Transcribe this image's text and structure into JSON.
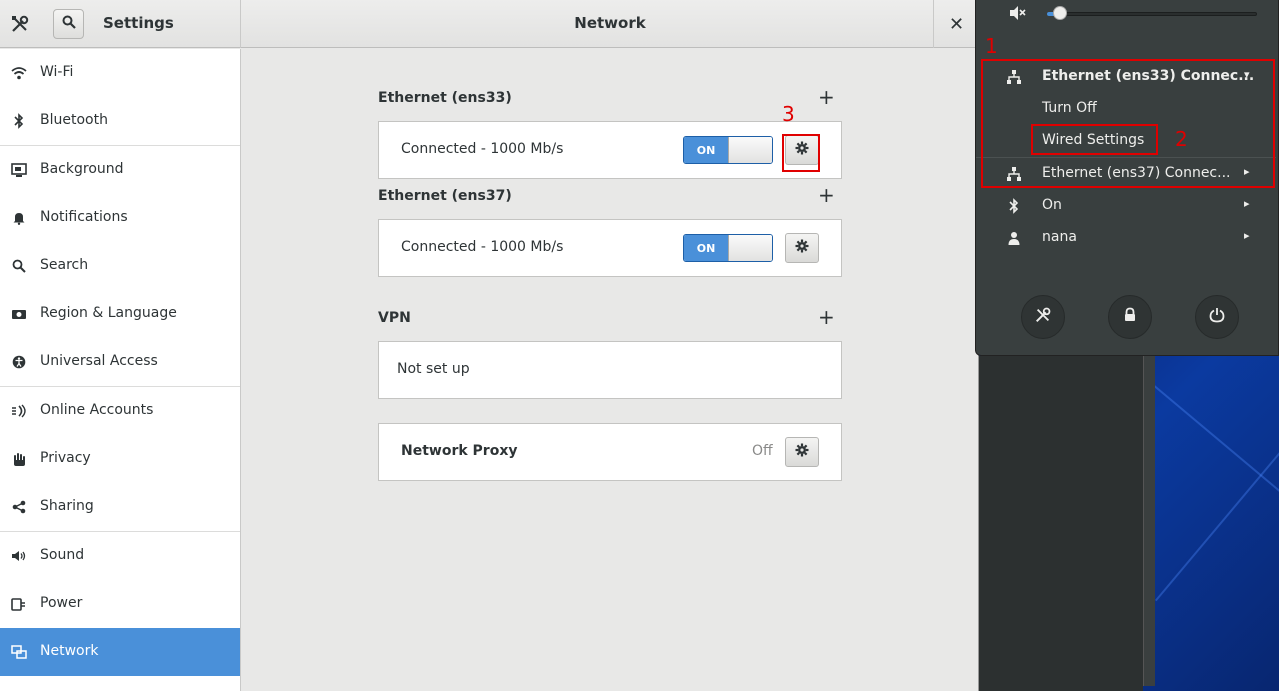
{
  "window": {
    "app_title": "Settings",
    "panel_title": "Network",
    "close_glyph": "✕"
  },
  "sidebar": {
    "items": [
      {
        "label": "Wi-Fi",
        "icon": "wifi-icon"
      },
      {
        "label": "Bluetooth",
        "icon": "bluetooth-icon"
      },
      {
        "label": "Background",
        "icon": "background-icon"
      },
      {
        "label": "Notifications",
        "icon": "bell-icon"
      },
      {
        "label": "Search",
        "icon": "search-icon"
      },
      {
        "label": "Region & Language",
        "icon": "camera-icon"
      },
      {
        "label": "Universal Access",
        "icon": "accessibility-icon"
      },
      {
        "label": "Online Accounts",
        "icon": "online-accounts-icon"
      },
      {
        "label": "Privacy",
        "icon": "hand-icon"
      },
      {
        "label": "Sharing",
        "icon": "share-icon"
      },
      {
        "label": "Sound",
        "icon": "speaker-icon"
      },
      {
        "label": "Power",
        "icon": "power-plug-icon"
      },
      {
        "label": "Network",
        "icon": "network-icon",
        "active": true
      }
    ]
  },
  "main": {
    "ethernet1": {
      "title": "Ethernet (ens33)",
      "status": "Connected - 1000 Mb/s",
      "toggle": "ON"
    },
    "ethernet2": {
      "title": "Ethernet (ens37)",
      "status": "Connected - 1000 Mb/s",
      "toggle": "ON"
    },
    "vpn": {
      "title": "VPN",
      "status": "Not set up"
    },
    "proxy": {
      "label": "Network Proxy",
      "value": "Off"
    },
    "plus_glyph": "+"
  },
  "annotations": {
    "n1": "1",
    "n2": "2",
    "n3": "3"
  },
  "sysmenu": {
    "volume_level": 0.06,
    "rows": [
      {
        "label": "Ethernet (ens33) Connec...",
        "icon": "wired-network-icon",
        "arrow": "▾"
      },
      {
        "label": "Turn Off"
      },
      {
        "label": "Wired Settings"
      },
      {
        "label": "Ethernet (ens37) Connec...",
        "icon": "wired-network-icon",
        "arrow": "▸"
      },
      {
        "label": "On",
        "icon": "bluetooth-icon",
        "arrow": "▸"
      },
      {
        "label": "nana",
        "icon": "user-icon",
        "arrow": "▸"
      }
    ],
    "colors": {
      "accent": "#4a90d9",
      "annotation": "#e00000"
    }
  }
}
